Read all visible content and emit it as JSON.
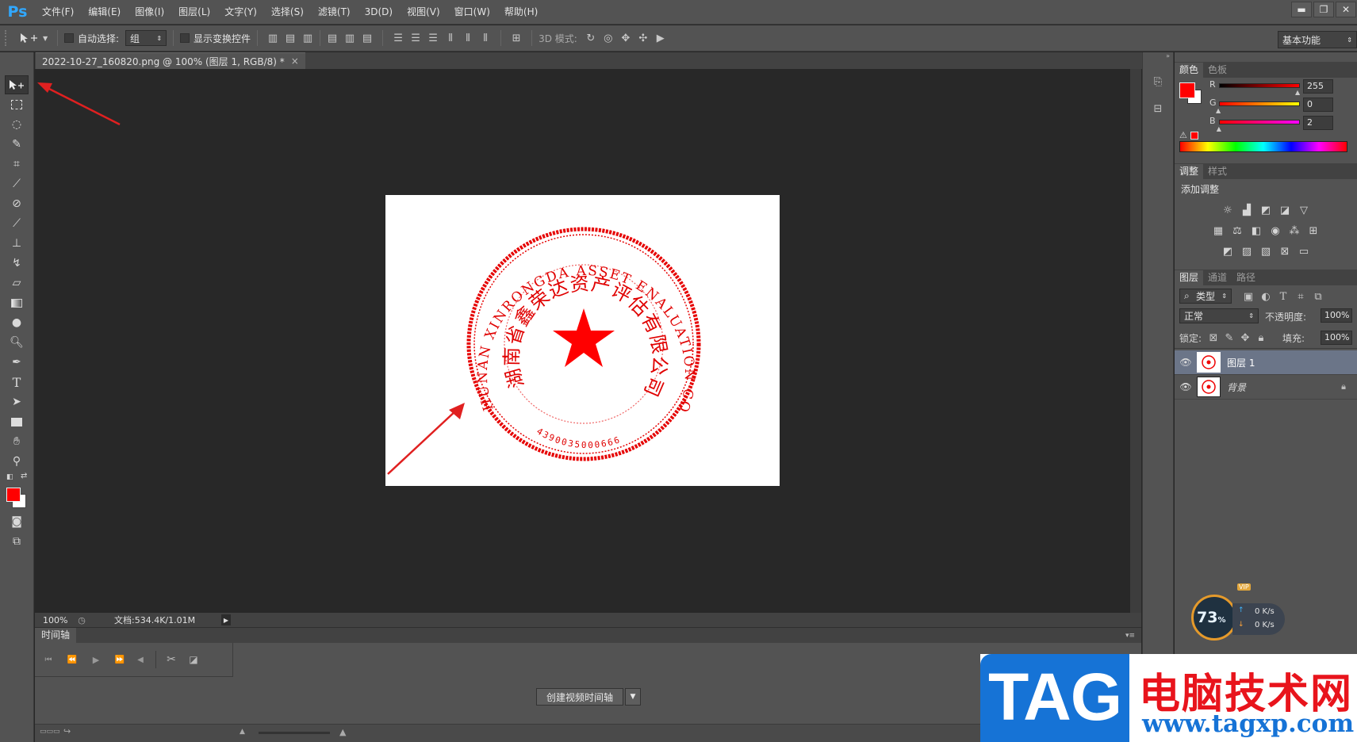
{
  "app": {
    "logo": "Ps"
  },
  "menu": [
    "文件(F)",
    "编辑(E)",
    "图像(I)",
    "图层(L)",
    "文字(Y)",
    "选择(S)",
    "滤镜(T)",
    "3D(D)",
    "视图(V)",
    "窗口(W)",
    "帮助(H)"
  ],
  "window_controls": {
    "minimize": "▬",
    "restore": "❐",
    "close": "✕"
  },
  "options": {
    "auto_select_label": "自动选择:",
    "auto_select_value": "组",
    "show_transform_label": "显示变换控件",
    "mode_3d_label": "3D 模式:",
    "workspace": "基本功能"
  },
  "document": {
    "tab_title": "2022-10-27_160820.png @ 100% (图层 1, RGB/8) *",
    "tab_close": "×",
    "zoom": "100%",
    "doc_size": "文档:534.4K/1.01M"
  },
  "stamp": {
    "outer_text": "HUNAN XINRONGDA ASSET ENALUATION CO.,LTD",
    "inner_text": "湖南省鑫荣达资产评估有限公司",
    "number": "4390035000666"
  },
  "timeline": {
    "tab": "时间轴",
    "create_button": "创建视频时间轴"
  },
  "color_panel": {
    "tabs": [
      "颜色",
      "色板"
    ],
    "channels": [
      {
        "label": "R",
        "value": "255",
        "fraction": 1.0
      },
      {
        "label": "G",
        "value": "0",
        "fraction": 0.0
      },
      {
        "label": "B",
        "value": "2",
        "fraction": 0.008
      }
    ],
    "foreground": "#ff0000",
    "background": "#ffffff"
  },
  "adjustments_panel": {
    "tabs": [
      "调整",
      "样式"
    ],
    "caption": "添加调整"
  },
  "layers_panel": {
    "tabs": [
      "图层",
      "通道",
      "路径"
    ],
    "filter_kind": "类型",
    "blend_mode": "正常",
    "opacity_label": "不透明度:",
    "opacity_value": "100%",
    "lock_label": "锁定:",
    "fill_label": "填充:",
    "fill_value": "100%",
    "layers": [
      {
        "name": "图层 1",
        "selected": true
      },
      {
        "name": "背景",
        "selected": false
      }
    ]
  },
  "net_widget": {
    "percent": "73",
    "percent_sign": "%",
    "up": "0 K/s",
    "down": "0 K/s",
    "badge": "VIP"
  },
  "watermark": {
    "tag": "TAG",
    "cn": "电脑技术网",
    "url": "www.tagxp.com"
  }
}
